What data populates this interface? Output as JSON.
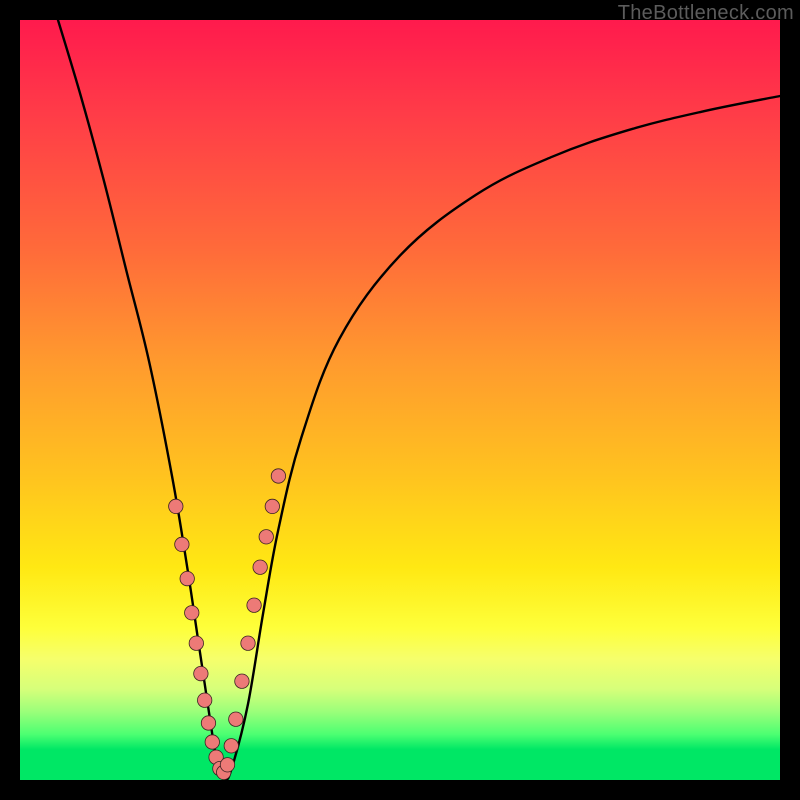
{
  "watermark": "TheBottleneck.com",
  "colors": {
    "curve_stroke": "#000000",
    "marker_fill": "#ed7a77",
    "marker_stroke": "#3a2222"
  },
  "chart_data": {
    "type": "line",
    "title": "",
    "xlabel": "",
    "ylabel": "",
    "xlim": [
      0,
      100
    ],
    "ylim": [
      0,
      100
    ],
    "series": [
      {
        "name": "bottleneck-curve",
        "x": [
          5,
          8,
          11,
          14,
          17,
          20,
          22,
          23.5,
          25,
          26,
          27,
          28,
          30,
          32,
          34,
          37,
          42,
          50,
          60,
          70,
          80,
          90,
          100
        ],
        "y": [
          100,
          90,
          79,
          67,
          55,
          40,
          28,
          18,
          8,
          2,
          0,
          2,
          10,
          22,
          33,
          45,
          58,
          69,
          77,
          82,
          85.5,
          88,
          90
        ]
      }
    ],
    "markers": {
      "name": "highlighted-points",
      "x": [
        20.5,
        21.3,
        22.0,
        22.6,
        23.2,
        23.8,
        24.3,
        24.8,
        25.3,
        25.8,
        26.3,
        26.8,
        27.3,
        27.8,
        28.4,
        29.2,
        30.0,
        30.8,
        31.6,
        32.4,
        33.2,
        34.0
      ],
      "y": [
        36,
        31,
        26.5,
        22,
        18,
        14,
        10.5,
        7.5,
        5,
        3,
        1.5,
        1,
        2,
        4.5,
        8,
        13,
        18,
        23,
        28,
        32,
        36,
        40
      ]
    }
  }
}
